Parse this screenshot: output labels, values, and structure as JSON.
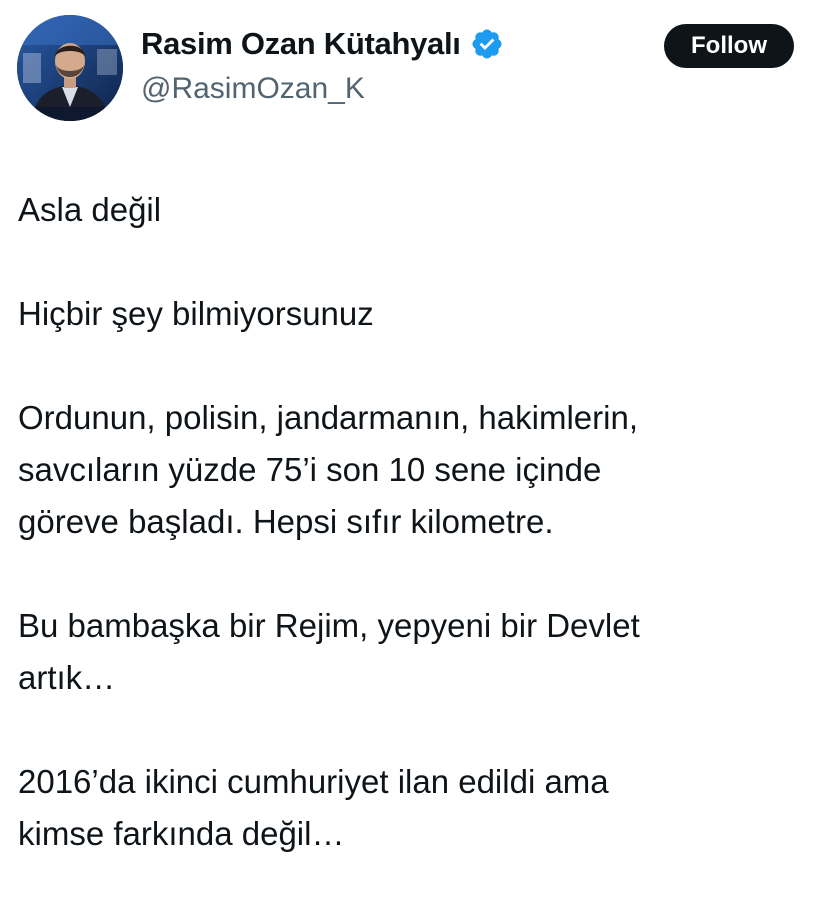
{
  "author": {
    "display_name": "Rasim Ozan Kütahyalı",
    "handle": "@RasimOzan_K",
    "verified": true,
    "verified_icon": "verified-badge-icon",
    "verified_color": "#1d9bf0"
  },
  "actions": {
    "follow_label": "Follow"
  },
  "tweet": {
    "paragraphs": [
      "Asla değil",
      "Hiçbir şey bilmiyorsunuz",
      "Ordunun, polisin, jandarmanın, hakimlerin,\nsavcıların yüzde 75’i son 10 sene içinde\ngöreve başladı. Hepsi sıfır kilometre.",
      "Bu bambaşka bir Rejim, yepyeni bir Devlet\nartık…",
      "2016’da ikinci cumhuriyet ilan edildi ama\nkimse farkında değil…"
    ]
  },
  "colors": {
    "text": "#0f1419",
    "secondary_text": "#536471",
    "button_bg": "#0f1419"
  }
}
